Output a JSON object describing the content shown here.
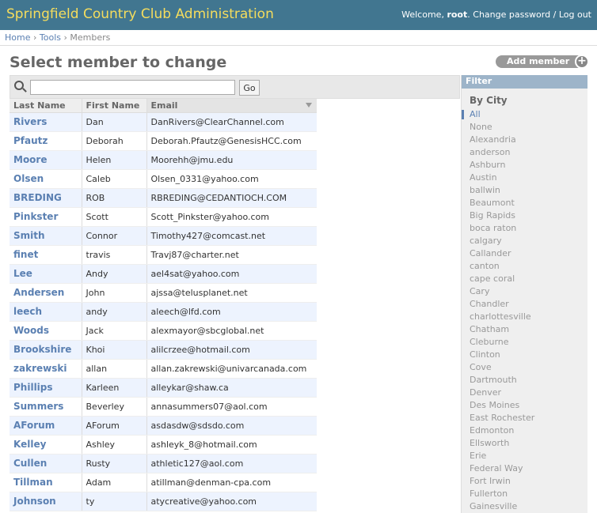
{
  "header": {
    "title": "Springfield Country Club Administration",
    "welcome": "Welcome,",
    "username": "root",
    "change_password": "Change password",
    "separator": "/",
    "logout": "Log out"
  },
  "breadcrumbs": {
    "home": "Home",
    "tools": "Tools",
    "current": "Members",
    "sep": "›"
  },
  "page": {
    "title": "Select member to change",
    "add_button": "Add member",
    "add_icon": "+"
  },
  "search": {
    "value": "",
    "placeholder": "",
    "go_label": "Go"
  },
  "table": {
    "columns": [
      "Last Name",
      "First Name",
      "Email"
    ],
    "sorted_column": "Email",
    "rows": [
      [
        "Rivers",
        "Dan",
        "DanRivers@ClearChannel.com"
      ],
      [
        "Pfautz",
        "Deborah",
        "Deborah.Pfautz@GenesisHCC.com"
      ],
      [
        "Moore",
        "Helen",
        "Moorehh@jmu.edu"
      ],
      [
        "Olsen",
        "Caleb",
        "Olsen_0331@yahoo.com"
      ],
      [
        "BREDING",
        "ROB",
        "RBREDING@CEDANTIOCH.COM"
      ],
      [
        "Pinkster",
        "Scott",
        "Scott_Pinkster@yahoo.com"
      ],
      [
        "Smith",
        "Connor",
        "Timothy427@comcast.net"
      ],
      [
        "finet",
        "travis",
        "Travj87@charter.net"
      ],
      [
        "Lee",
        "Andy",
        "ael4sat@yahoo.com"
      ],
      [
        "Andersen",
        "John",
        "ajssa@telusplanet.net"
      ],
      [
        "leech",
        "andy",
        "aleech@lfd.com"
      ],
      [
        "Woods",
        "Jack",
        "alexmayor@sbcglobal.net"
      ],
      [
        "Brookshire",
        "Khoi",
        "alilcrzee@hotmail.com"
      ],
      [
        "zakrewski",
        "allan",
        "allan.zakrewski@univarcanada.com"
      ],
      [
        "Phillips",
        "Karleen",
        "alleykar@shaw.ca"
      ],
      [
        "Summers",
        "Beverley",
        "annasummers07@aol.com"
      ],
      [
        "AForum",
        "AForum",
        "asdasdw@sdsdo.com"
      ],
      [
        "Kelley",
        "Ashley",
        "ashleyk_8@hotmail.com"
      ],
      [
        "Cullen",
        "Rusty",
        "athletic127@aol.com"
      ],
      [
        "Tillman",
        "Adam",
        "atillman@denman-cpa.com"
      ],
      [
        "Johnson",
        "ty",
        "atycreative@yahoo.com"
      ]
    ]
  },
  "filter": {
    "title": "Filter",
    "heading": "By City",
    "selected": "All",
    "options": [
      "All",
      "None",
      "Alexandria",
      "anderson",
      "Ashburn",
      "Austin",
      "ballwin",
      "Beaumont",
      "Big Rapids",
      "boca raton",
      "calgary",
      "Callander",
      "canton",
      "cape coral",
      "Cary",
      "Chandler",
      "charlottesville",
      "Chatham",
      "Cleburne",
      "Clinton",
      "Cove",
      "Dartmouth",
      "Denver",
      "Des Moines",
      "East Rochester",
      "Edmonton",
      "Ellsworth",
      "Erie",
      "Federal Way",
      "Fort Irwin",
      "Fullerton",
      "Gainesville"
    ]
  },
  "colors": {
    "header_bg": "#417690",
    "title_color": "#f5dd5d",
    "link": "#5b80b2",
    "row_alt": "#edf3fe",
    "filter_title_bg": "#9db4c9"
  }
}
